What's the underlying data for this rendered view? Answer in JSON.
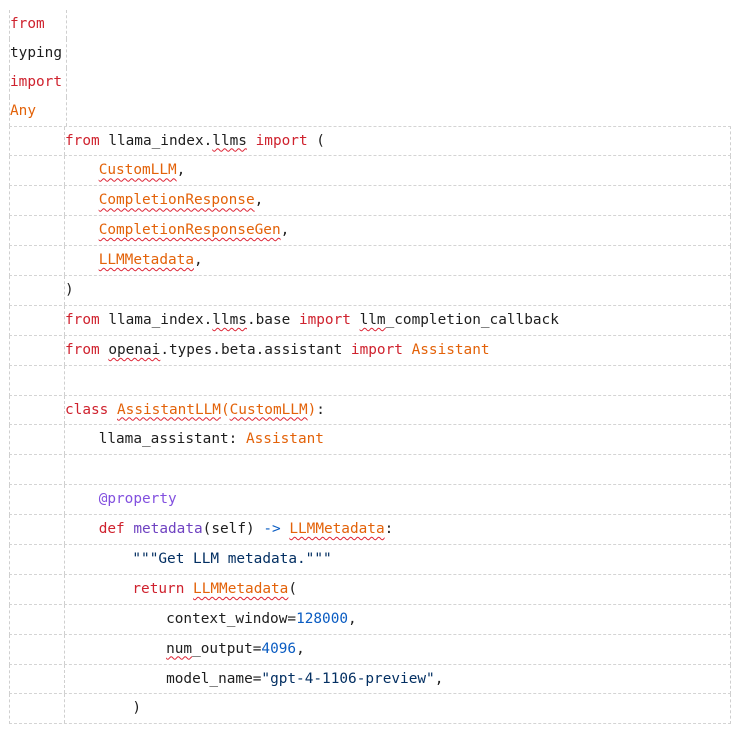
{
  "editor": {
    "lines": [
      {
        "kind": "narrow",
        "indent": 0,
        "tokens": [
          {
            "t": "from",
            "c": "kw"
          }
        ]
      },
      {
        "kind": "narrow",
        "indent": 0,
        "tokens": [
          {
            "t": "typing",
            "c": ""
          }
        ]
      },
      {
        "kind": "narrow",
        "indent": 0,
        "tokens": [
          {
            "t": "import",
            "c": "kw"
          }
        ]
      },
      {
        "kind": "narrow",
        "indent": 0,
        "tokens": [
          {
            "t": "Any",
            "c": "cls"
          }
        ]
      },
      {
        "kind": "wide",
        "indent": 0,
        "tokens": [
          {
            "t": "from",
            "c": "kw"
          },
          {
            "t": " llama_index.",
            "c": ""
          },
          {
            "t": "llms",
            "c": "sq"
          },
          {
            "t": " ",
            "c": ""
          },
          {
            "t": "import",
            "c": "kw"
          },
          {
            "t": " (",
            "c": ""
          }
        ]
      },
      {
        "kind": "wide",
        "indent": 1,
        "tokens": [
          {
            "t": "CustomLLM",
            "c": "cls sq"
          },
          {
            "t": ",",
            "c": ""
          }
        ]
      },
      {
        "kind": "wide",
        "indent": 1,
        "tokens": [
          {
            "t": "CompletionResponse",
            "c": "cls sq"
          },
          {
            "t": ",",
            "c": ""
          }
        ]
      },
      {
        "kind": "wide",
        "indent": 1,
        "tokens": [
          {
            "t": "CompletionResponseGen",
            "c": "cls sq"
          },
          {
            "t": ",",
            "c": ""
          }
        ]
      },
      {
        "kind": "wide",
        "indent": 1,
        "tokens": [
          {
            "t": "LLMMetadata",
            "c": "cls sq"
          },
          {
            "t": ",",
            "c": ""
          }
        ]
      },
      {
        "kind": "wide",
        "indent": 0,
        "tokens": [
          {
            "t": ")",
            "c": ""
          }
        ]
      },
      {
        "kind": "wide",
        "indent": 0,
        "tokens": [
          {
            "t": "from",
            "c": "kw"
          },
          {
            "t": " llama_index.",
            "c": ""
          },
          {
            "t": "llms",
            "c": "sq"
          },
          {
            "t": ".base ",
            "c": ""
          },
          {
            "t": "import",
            "c": "kw"
          },
          {
            "t": " ",
            "c": ""
          },
          {
            "t": "llm",
            "c": "sq"
          },
          {
            "t": "_completion_callback",
            "c": ""
          }
        ]
      },
      {
        "kind": "wide",
        "indent": 0,
        "tokens": [
          {
            "t": "from",
            "c": "kw"
          },
          {
            "t": " ",
            "c": ""
          },
          {
            "t": "openai",
            "c": "sq"
          },
          {
            "t": ".types.beta.assistant ",
            "c": ""
          },
          {
            "t": "import",
            "c": "kw"
          },
          {
            "t": " ",
            "c": ""
          },
          {
            "t": "Assistant",
            "c": "cls"
          }
        ]
      },
      {
        "kind": "wide",
        "indent": 0,
        "tokens": []
      },
      {
        "kind": "wide",
        "indent": 0,
        "tokens": [
          {
            "t": "class",
            "c": "kw"
          },
          {
            "t": " ",
            "c": ""
          },
          {
            "t": "AssistantLLM",
            "c": "cls sq"
          },
          {
            "t": "(",
            "c": "cls"
          },
          {
            "t": "CustomLLM",
            "c": "cls sq"
          },
          {
            "t": ")",
            "c": "cls"
          },
          {
            "t": ":",
            "c": ""
          }
        ]
      },
      {
        "kind": "wide",
        "indent": 1,
        "tokens": [
          {
            "t": "llama_assistant: ",
            "c": ""
          },
          {
            "t": "Assistant",
            "c": "cls"
          }
        ]
      },
      {
        "kind": "wide",
        "indent": 0,
        "tokens": []
      },
      {
        "kind": "wide",
        "indent": 1,
        "tokens": [
          {
            "t": "@property",
            "c": "deco"
          }
        ]
      },
      {
        "kind": "wide",
        "indent": 1,
        "tokens": [
          {
            "t": "def",
            "c": "kw"
          },
          {
            "t": " ",
            "c": ""
          },
          {
            "t": "metadata",
            "c": "fn"
          },
          {
            "t": "(self) ",
            "c": ""
          },
          {
            "t": "->",
            "c": "arrow"
          },
          {
            "t": " ",
            "c": ""
          },
          {
            "t": "LLMMetadata",
            "c": "cls sq"
          },
          {
            "t": ":",
            "c": ""
          }
        ]
      },
      {
        "kind": "wide",
        "indent": 2,
        "tokens": [
          {
            "t": "\"\"\"Get LLM metadata.\"\"\"",
            "c": "str"
          }
        ]
      },
      {
        "kind": "wide",
        "indent": 2,
        "tokens": [
          {
            "t": "return",
            "c": "kw"
          },
          {
            "t": " ",
            "c": ""
          },
          {
            "t": "LLMMetadata",
            "c": "cls sq"
          },
          {
            "t": "(",
            "c": ""
          }
        ]
      },
      {
        "kind": "wide",
        "indent": 3,
        "tokens": [
          {
            "t": "context_window=",
            "c": ""
          },
          {
            "t": "128000",
            "c": "num"
          },
          {
            "t": ",",
            "c": ""
          }
        ]
      },
      {
        "kind": "wide",
        "indent": 3,
        "tokens": [
          {
            "t": "num",
            "c": "sq"
          },
          {
            "t": "_output=",
            "c": ""
          },
          {
            "t": "4096",
            "c": "num"
          },
          {
            "t": ",",
            "c": ""
          }
        ]
      },
      {
        "kind": "wide",
        "indent": 3,
        "tokens": [
          {
            "t": "model_name=",
            "c": ""
          },
          {
            "t": "\"gpt-4-1106-preview\"",
            "c": "str"
          },
          {
            "t": ",",
            "c": ""
          }
        ]
      },
      {
        "kind": "wide",
        "indent": 2,
        "tokens": [
          {
            "t": ")",
            "c": ""
          }
        ]
      }
    ]
  }
}
